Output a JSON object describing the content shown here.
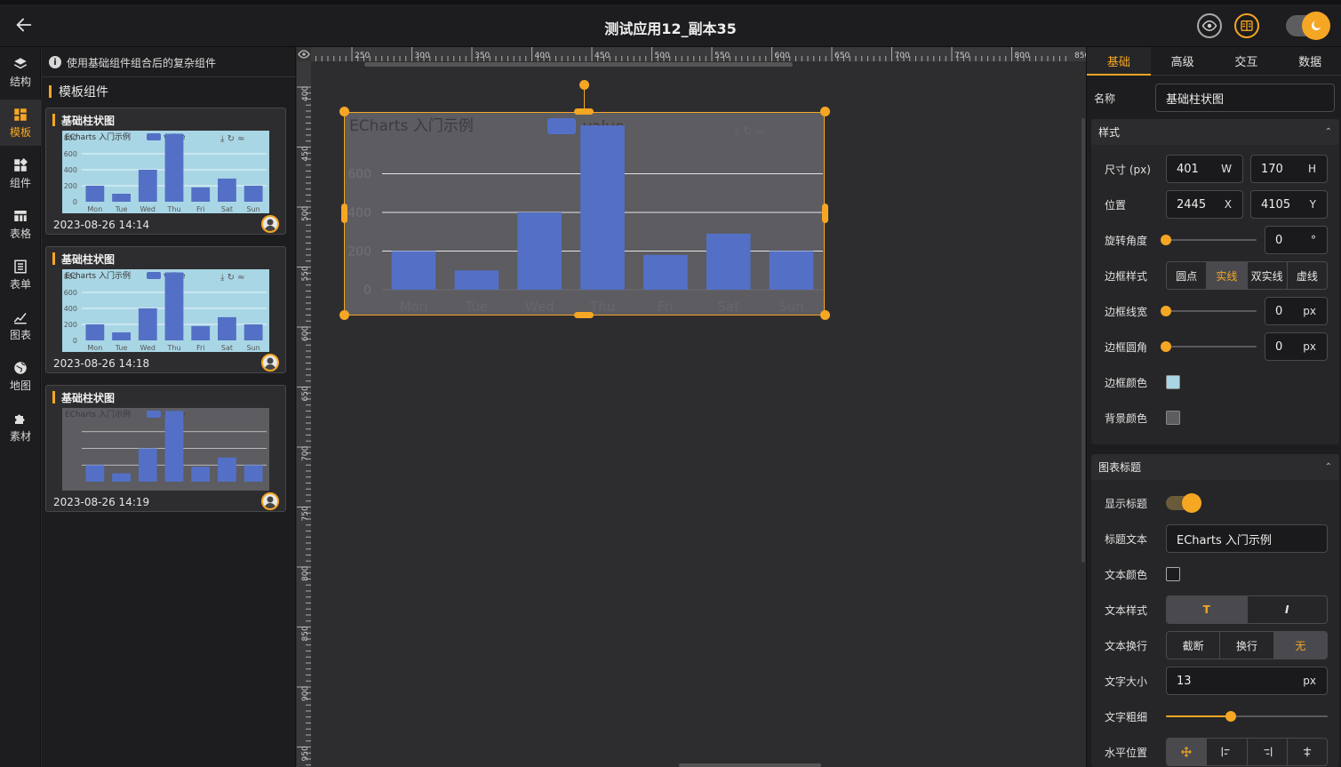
{
  "app": {
    "title": "测试应用12_副本35"
  },
  "colors": {
    "accent": "#f5a623",
    "bar": "#5470c6",
    "thumb_bg": "#a9d6e5",
    "chart_bg": "#5c5c61"
  },
  "rail": {
    "items": [
      {
        "label": "结构",
        "icon": "layers-icon"
      },
      {
        "label": "模板",
        "icon": "template-icon"
      },
      {
        "label": "组件",
        "icon": "components-icon"
      },
      {
        "label": "表格",
        "icon": "table-icon"
      },
      {
        "label": "表单",
        "icon": "form-icon"
      },
      {
        "label": "图表",
        "icon": "chart-icon"
      },
      {
        "label": "地图",
        "icon": "globe-icon"
      },
      {
        "label": "素材",
        "icon": "puzzle-icon"
      }
    ]
  },
  "templates": {
    "tip": "使用基础组件组合后的复杂组件",
    "section": "模板组件",
    "cards": [
      {
        "title": "基础柱状图",
        "date": "2023-08-26 14:14"
      },
      {
        "title": "基础柱状图",
        "date": "2023-08-26 14:18"
      },
      {
        "title": "基础柱状图",
        "date": "2023-08-26 14:19"
      }
    ],
    "thumb_chart": {
      "title": "ECharts 入门示例",
      "legend": "value",
      "categories": [
        "Mon",
        "Tue",
        "Wed",
        "Thu",
        "Fri",
        "Sat",
        "Sun"
      ],
      "ticks": [
        "0",
        "200",
        "400",
        "600",
        "800"
      ]
    }
  },
  "canvas": {
    "ruler_h": [
      "250",
      "300",
      "350",
      "400",
      "450",
      "500",
      "550",
      "600",
      "650",
      "700",
      "750",
      "800",
      "850"
    ],
    "ruler_v": [
      "400",
      "450",
      "500",
      "550",
      "600",
      "650",
      "700",
      "750",
      "800",
      "850",
      "900",
      "950"
    ]
  },
  "chart_data": {
    "type": "bar",
    "title": "ECharts 入门示例",
    "legend": "value",
    "categories": [
      "Mon",
      "Tue",
      "Wed",
      "Thu",
      "Fri",
      "Sat",
      "Sun"
    ],
    "series": [
      {
        "name": "value",
        "values": [
          200,
          100,
          400,
          850,
          180,
          290,
          200
        ]
      }
    ],
    "yticks": [
      "0",
      "200",
      "400",
      "600"
    ],
    "ylim": [
      0,
      800
    ]
  },
  "props": {
    "tabs": [
      "基础",
      "高级",
      "交互",
      "数据"
    ],
    "name_label": "名称",
    "name_value": "基础柱状图",
    "style_group": "样式",
    "size_label": "尺寸 (px)",
    "width": "401",
    "width_unit": "W",
    "height": "170",
    "height_unit": "H",
    "pos_label": "位置",
    "x": "2445",
    "x_unit": "X",
    "y": "4105",
    "y_unit": "Y",
    "rotate_label": "旋转角度",
    "rotate_value": "0",
    "rotate_unit": "°",
    "border_style_label": "边框样式",
    "border_styles": [
      "圆点",
      "实线",
      "双实线",
      "虚线"
    ],
    "border_width_label": "边框线宽",
    "border_width_value": "0",
    "border_width_unit": "px",
    "border_radius_label": "边框圆角",
    "border_radius_value": "0",
    "border_radius_unit": "px",
    "border_color_label": "边框颜色",
    "border_color": "#a9d6e5",
    "bg_color_label": "背景颜色",
    "bg_color": "#5c5c61",
    "title_group": "图表标题",
    "show_title_label": "显示标题",
    "title_text_label": "标题文本",
    "title_text_value": "ECharts 入门示例",
    "text_color_label": "文本颜色",
    "text_style_label": "文本样式",
    "text_style_bold": "T",
    "text_style_italic": "I",
    "wrap_label": "文本换行",
    "wrap_options": [
      "截断",
      "换行",
      "无"
    ],
    "font_size_label": "文字大小",
    "font_size_value": "13",
    "font_size_unit": "px",
    "font_weight_label": "文字粗细",
    "font_weight_level": 0.4,
    "h_align_label": "水平位置"
  }
}
